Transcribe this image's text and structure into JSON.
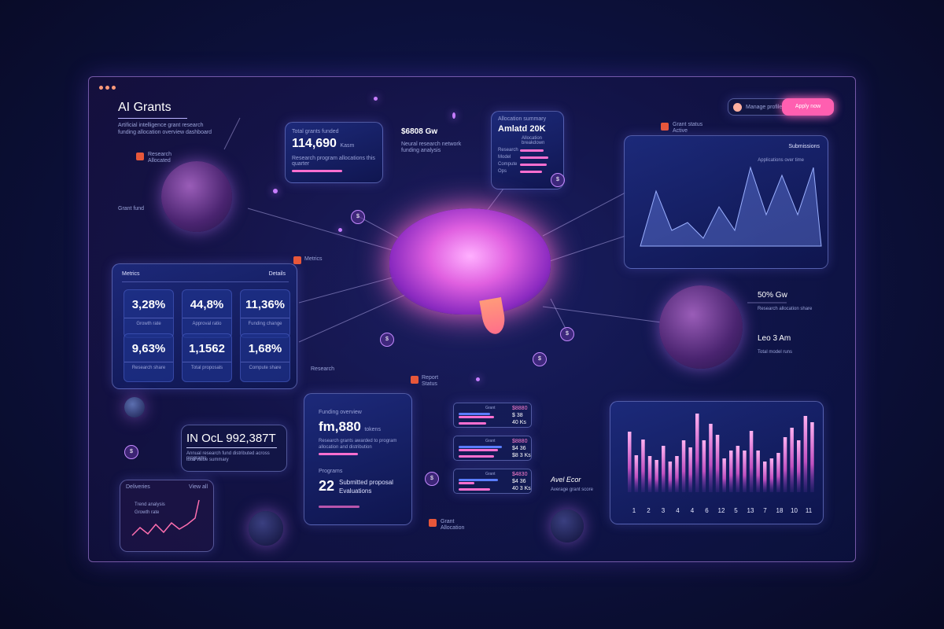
{
  "header": {
    "title": "AI Grants",
    "subtitle_1": "Artificial intelligence grant research",
    "subtitle_2": "funding allocation overview dashboard",
    "legend_1": "Research",
    "legend_2": "Allocated"
  },
  "top_actions": {
    "user_label": "Manage profile",
    "primary_button": "Apply now"
  },
  "card_top": {
    "caption": "Total grants funded",
    "value": "114,690",
    "unit": "Kasm",
    "desc": "Research program allocations this quarter"
  },
  "mid_text": {
    "value": "$6808 Gw",
    "desc_1": "Neural research network",
    "desc_2": "funding analysis"
  },
  "card_alloc": {
    "caption": "Allocation summary",
    "title": "Amlatd 20K",
    "header": "Allocation breakdown",
    "rows": [
      {
        "label": "Research"
      },
      {
        "label": "Model"
      },
      {
        "label": "Compute"
      },
      {
        "label": "Ops"
      }
    ]
  },
  "top_right_note": {
    "line_1": "Grant status",
    "line_2": "Active"
  },
  "wave_chart": {
    "title": "Submissions",
    "subtitle": "Applications over time"
  },
  "metrics": {
    "title": "Metrics",
    "action": "Details",
    "items": [
      {
        "value": "3,28%",
        "label": "Growth rate"
      },
      {
        "value": "44,8%",
        "label": "Approval ratio"
      },
      {
        "value": "11,36%",
        "label": "Funding change"
      },
      {
        "value": "9,63%",
        "label": "Research share"
      },
      {
        "value": "1,1562",
        "label": "Total proposals"
      },
      {
        "value": "1,68%",
        "label": "Compute share"
      }
    ]
  },
  "left_notes": {
    "n1_a": "Research",
    "n1_b": "Allocations",
    "n2": "Grant fund",
    "n3": "Metrics"
  },
  "big_value": {
    "value": "IN OcL 992,387T",
    "desc_1": "Annual research fund distributed across programs",
    "desc_2": "total value summary"
  },
  "mini_chart": {
    "title": "Deliveries",
    "action": "View all",
    "l1": "Trend analysis",
    "l2": "Growth rate"
  },
  "card_bottom": {
    "caption": "Funding overview",
    "value": "fm,880",
    "unit": "tokens",
    "desc_1": "Research grants awarded to program",
    "desc_2": "allocation and distribution",
    "caption2": "Programs",
    "count": "22",
    "count_label_1": "Submitted proposal",
    "count_label_2": "Evaluations"
  },
  "mini_bars": [
    {
      "v1": "$8880",
      "v2": "$ 38",
      "v3": "40 Ks"
    },
    {
      "v1": "$8880",
      "v2": "$4 36",
      "v3": "$8 3 Ks"
    },
    {
      "v1": "$4830",
      "v2": "$4 36",
      "v3": "40 3 Ks"
    }
  ],
  "mini_bar_labels": [
    "Grant",
    "Grant",
    "Grant"
  ],
  "right_note": {
    "title": "Avel Ecor",
    "desc": "Average grant score"
  },
  "sphere_notes": {
    "v1": "50% Gw",
    "d1": "Research allocation share",
    "v2": "Leo 3 Am",
    "d2": "Total model runs"
  },
  "bottom_notes": {
    "a1": "Grant",
    "a2": "Allocation",
    "b1": "Report",
    "b2": "Status"
  },
  "chart_data": {
    "type": "bar",
    "title": "",
    "xlabel": "",
    "ylabel": "",
    "ylim": [
      0,
      100
    ],
    "values": [
      77,
      47,
      67,
      46,
      41,
      59,
      39,
      46,
      66,
      57,
      100,
      66,
      87,
      73,
      43,
      53,
      59,
      53,
      78,
      53,
      39,
      43,
      50,
      70,
      82,
      66,
      97,
      89
    ],
    "tick_labels": [
      "1",
      "2",
      "3",
      "4",
      "4",
      "6",
      "12",
      "5",
      "13",
      "7",
      "18",
      "10",
      "11"
    ]
  },
  "colors": {
    "accent": "#ff6fd0",
    "blue": "#5a7dff",
    "bg": "#0d1240"
  }
}
